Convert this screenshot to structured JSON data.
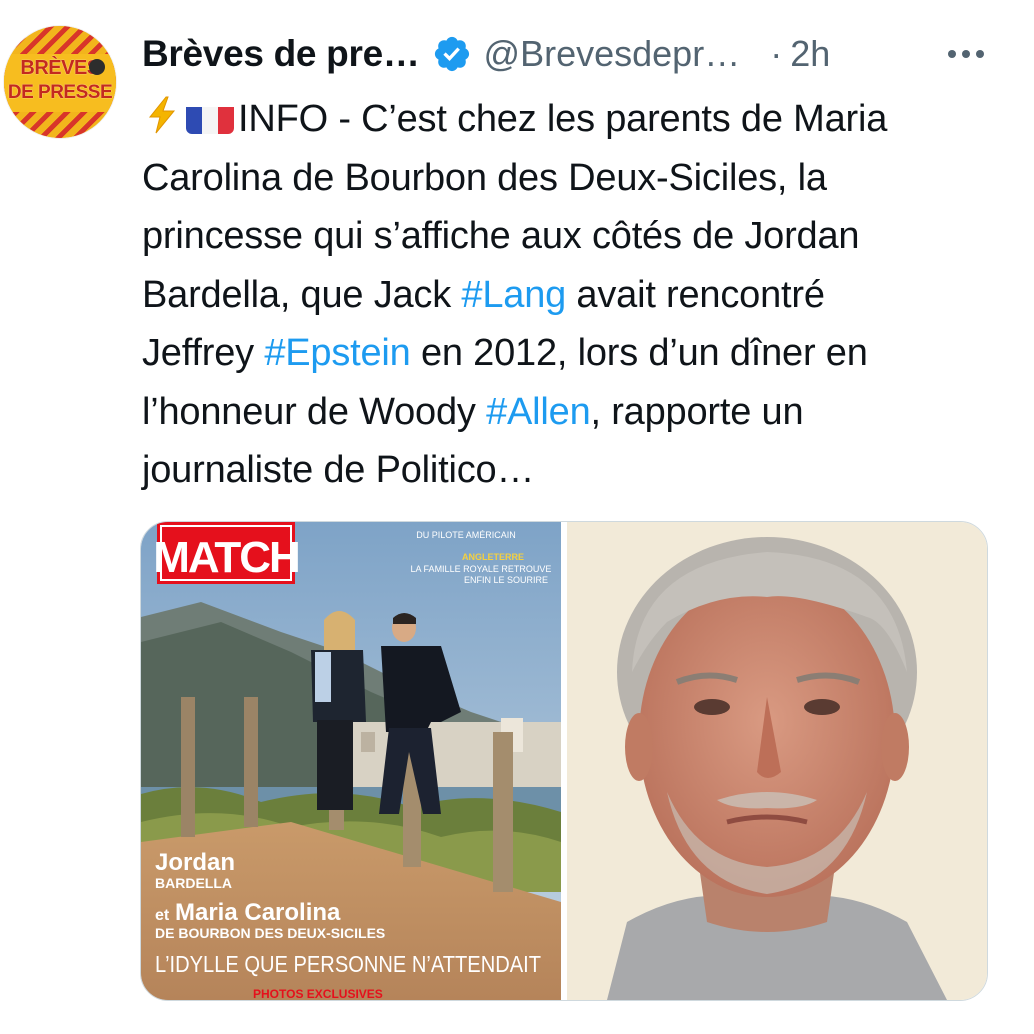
{
  "account": {
    "display_name": "Brèves de pre…",
    "handle": "@Brevesdepr…",
    "separator": "·",
    "time": "2h",
    "verified_icon": "verified-badge-icon",
    "avatar_text": [
      "BRÈVES",
      "DE PRESSE"
    ]
  },
  "tweet": {
    "lines": [
      [
        "INFO - C’est chez les parents de Maria"
      ],
      [
        "Carolina de Bourbon des Deux-Siciles, la"
      ],
      [
        "princesse qui s’affiche aux côtés de Jordan"
      ],
      [
        "Bardella, que Jack ",
        "#Lang",
        " avait rencontré"
      ],
      [
        "Jeffrey ",
        "#Epstein",
        " en 2012, lors d’un dîner en"
      ],
      [
        "l’honneur de Woody ",
        "#Allen",
        ", rapporte un"
      ],
      [
        "journaliste de Politico…"
      ]
    ]
  },
  "media": {
    "magazine": {
      "masthead": "MATCH",
      "top_line": "DU PILOTE AMÉRICAIN",
      "section": "ANGLETERRE",
      "headline_1": "LA FAMILLE ROYALE RETROUVE",
      "headline_2": "ENFIN LE SOURIRE",
      "name_1": "Jordan",
      "name_1_sub": "BARDELLA",
      "name_2_prefix": "et",
      "name_2": "Maria Carolina",
      "name_2_sub": "DE BOURBON DES DEUX-SICILES",
      "tagline": "L’IDYLLE QUE PERSONNE N’ATTENDAIT",
      "footer": "PHOTOS EXCLUSIVES"
    }
  },
  "colors": {
    "text": "#0f1419",
    "secondary": "#536471",
    "hashtag": "#1d9bf0",
    "verified": "#1d9bf0",
    "avatar_yellow": "#f2b51c",
    "avatar_red": "#c42a1f"
  }
}
